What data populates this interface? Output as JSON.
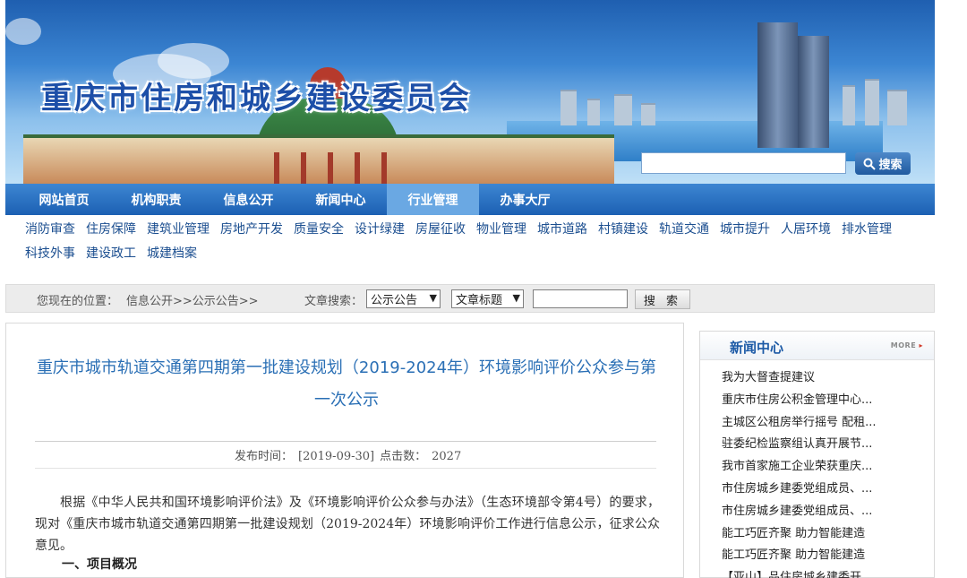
{
  "header": {
    "site_title": "重庆市住房和城乡建设委员会",
    "search_button": "搜索"
  },
  "nav": {
    "items": [
      {
        "label": "网站首页"
      },
      {
        "label": "机构职责"
      },
      {
        "label": "信息公开"
      },
      {
        "label": "新闻中心"
      },
      {
        "label": "行业管理",
        "active": true
      },
      {
        "label": "办事大厅"
      }
    ]
  },
  "subnav": {
    "items": [
      "消防审查",
      "住房保障",
      "建筑业管理",
      "房地产开发",
      "质量安全",
      "设计绿建",
      "房屋征收",
      "物业管理",
      "城市道路",
      "村镇建设",
      "轨道交通",
      "城市提升",
      "人居环境",
      "排水管理",
      "科技外事",
      "建设政工",
      "城建档案"
    ]
  },
  "location": {
    "label": "您现在的位置：",
    "path": "信息公开>>公示公告>>",
    "search_label": "文章搜索：",
    "category_select": "公示公告",
    "field_select": "文章标题",
    "search_button": "搜 索"
  },
  "article": {
    "title": "重庆市城市轨道交通第四期第一批建设规划（2019-2024年）环境影响评价公众参与第一次公示",
    "publish_label": "发布时间：",
    "publish_date": "[2019-09-30]",
    "clicks_label": "点击数：",
    "clicks": "2027",
    "body": "根据《中华人民共和国环境影响评价法》及《环境影响评价公众参与办法》（生态环境部令第4号）的要求，现对《重庆市城市轨道交通第四期第一批建设规划（2019-2024年）环境影响评价工作进行信息公示，征求公众意见。",
    "section1": "一、项目概况"
  },
  "sidebar": {
    "title": "新闻中心",
    "more": "MORE",
    "items": [
      "我为大督查提建议",
      "重庆市住房公积金管理中心...",
      "主城区公租房举行摇号 配租...",
      "驻委纪检监察组认真开展节...",
      "我市首家施工企业荣获重庆...",
      "市住房城乡建委党组成员、...",
      "市住房城乡建委党组成员、...",
      "能工巧匠齐聚 助力智能建造",
      "能工巧匠齐聚 助力智能建造",
      "【亚山】品住房城乡建委开..."
    ]
  },
  "colors": {
    "nav_bg": "#1c60b3",
    "nav_active": "#6aa8e3",
    "title_blue": "#2a6fb5",
    "link_blue": "#1c4f90"
  }
}
